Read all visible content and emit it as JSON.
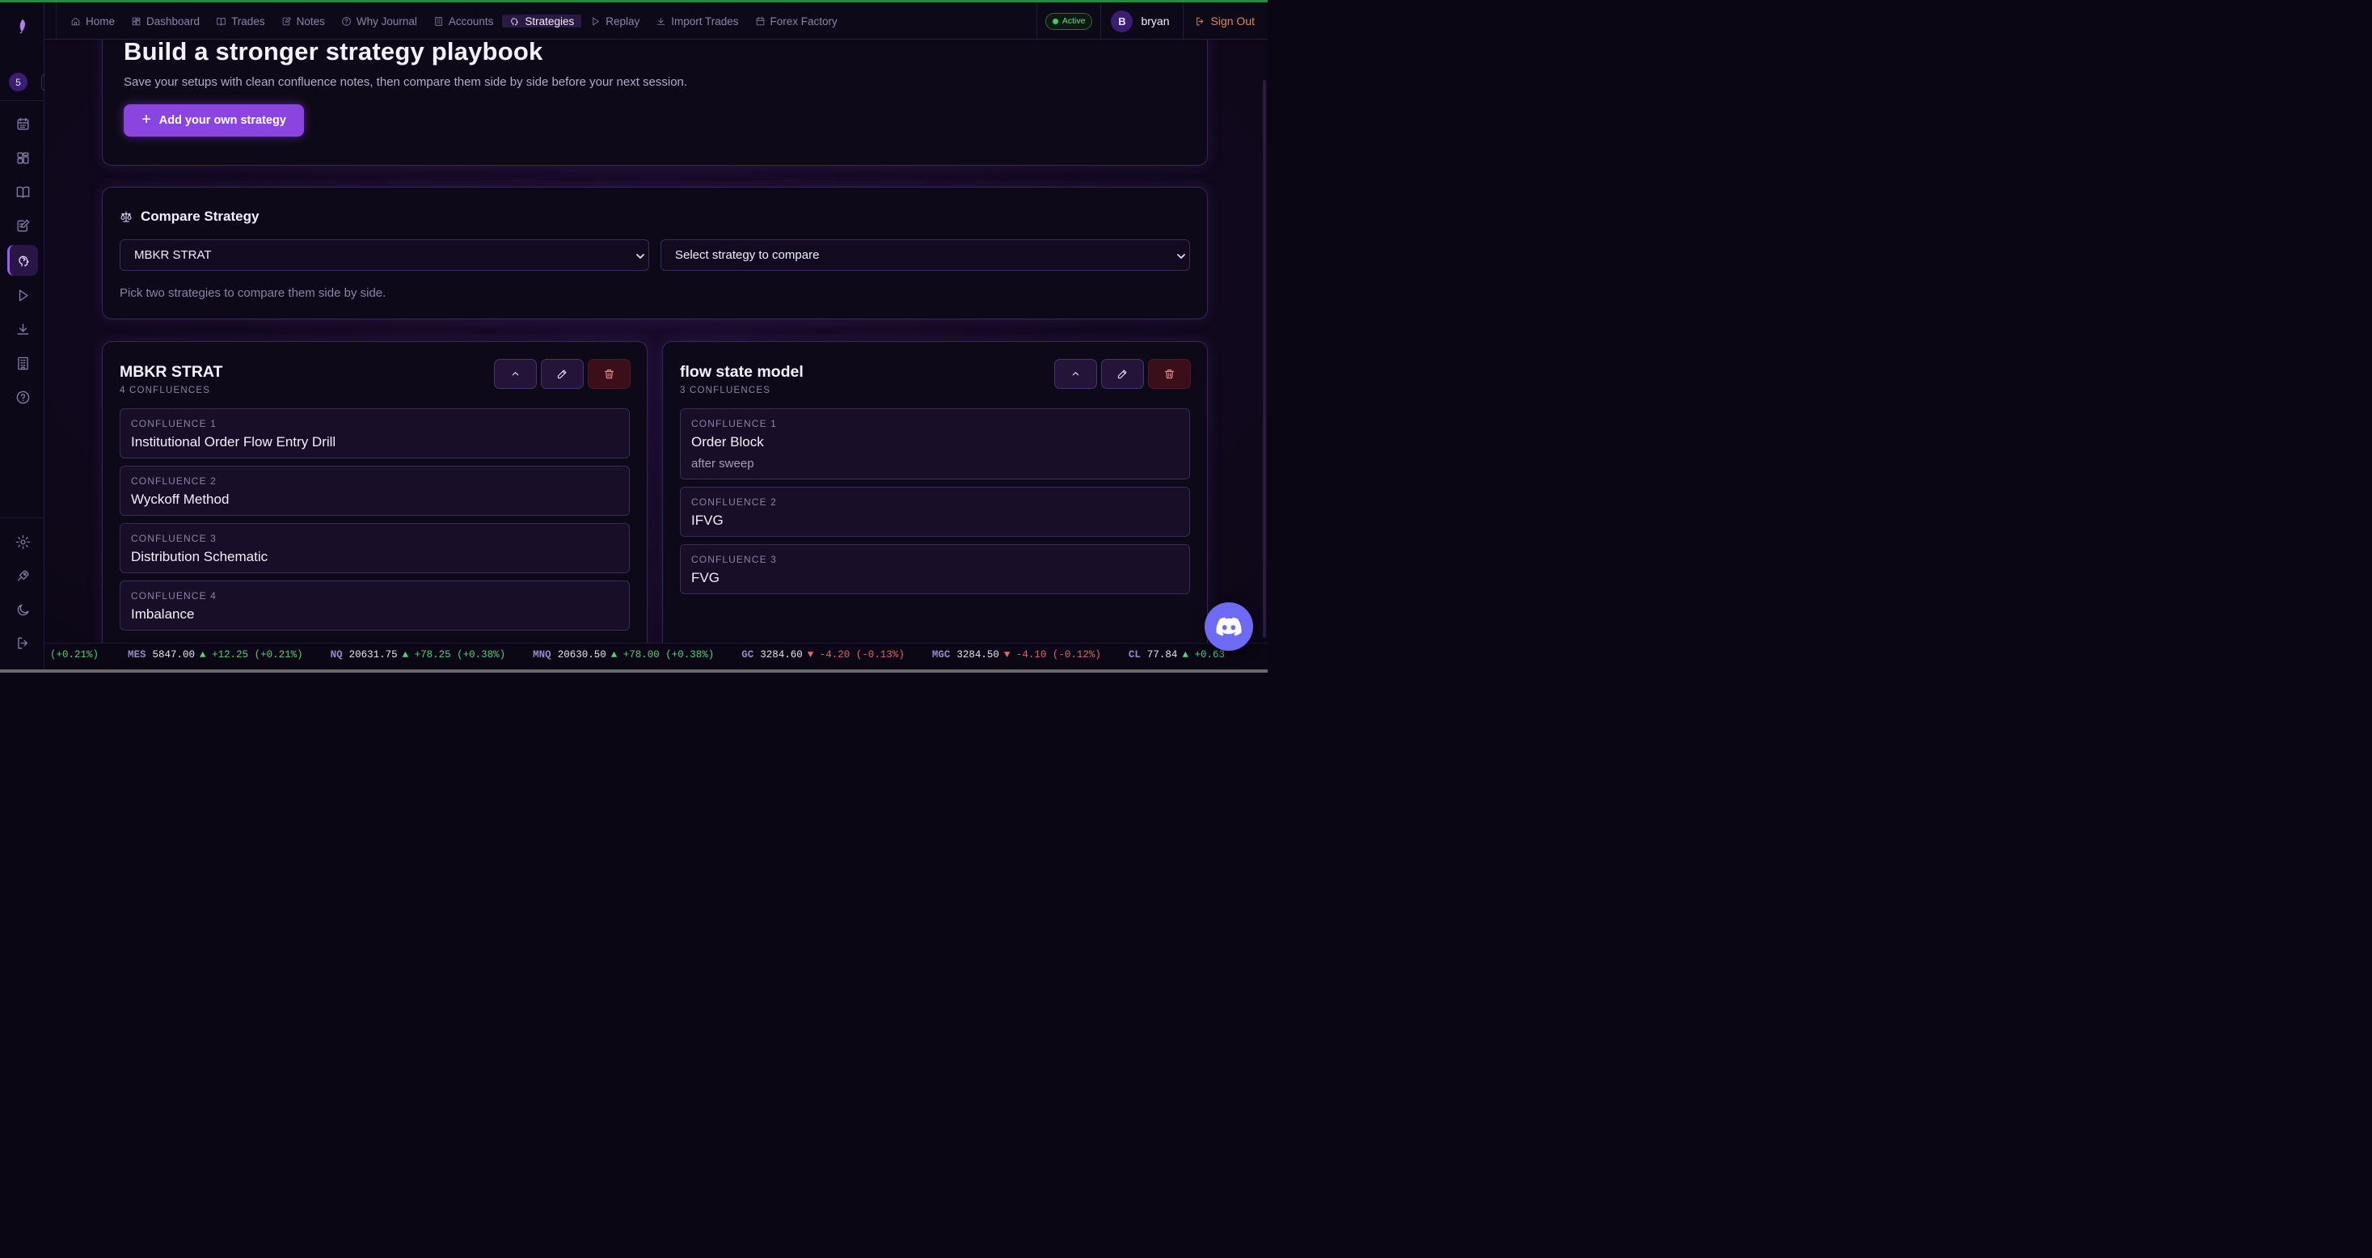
{
  "nav": {
    "items": [
      {
        "label": "Home",
        "icon": "home-icon"
      },
      {
        "label": "Dashboard",
        "icon": "dashboard-icon"
      },
      {
        "label": "Trades",
        "icon": "book-icon"
      },
      {
        "label": "Notes",
        "icon": "notes-icon"
      },
      {
        "label": "Why Journal",
        "icon": "help-icon"
      },
      {
        "label": "Accounts",
        "icon": "building-icon"
      },
      {
        "label": "Strategies",
        "icon": "brain-icon",
        "active": true
      },
      {
        "label": "Replay",
        "icon": "play-icon"
      },
      {
        "label": "Import Trades",
        "icon": "download-icon"
      },
      {
        "label": "Forex Factory",
        "icon": "calendar-icon"
      }
    ],
    "status": "Active",
    "user_initial": "B",
    "username": "bryan",
    "signout": "Sign Out"
  },
  "sidebar": {
    "badge_count": "5"
  },
  "hero": {
    "title": "Build a stronger strategy playbook",
    "subtitle": "Save your setups with clean confluence notes, then compare them side by side before your next session.",
    "add_button": "Add your own strategy"
  },
  "compare": {
    "title": "Compare Strategy",
    "left_selected": "MBKR STRAT",
    "right_placeholder": "Select strategy to compare",
    "hint": "Pick two strategies to compare them side by side."
  },
  "strategies": [
    {
      "name": "MBKR STRAT",
      "count": "4 CONFLUENCES",
      "confluences": [
        {
          "label": "CONFLUENCE 1",
          "value": "Institutional Order Flow Entry Drill",
          "note": ""
        },
        {
          "label": "CONFLUENCE 2",
          "value": "Wyckoff Method",
          "note": ""
        },
        {
          "label": "CONFLUENCE 3",
          "value": "Distribution Schematic",
          "note": ""
        },
        {
          "label": "CONFLUENCE 4",
          "value": "Imbalance",
          "note": ""
        }
      ]
    },
    {
      "name": "flow state model",
      "count": "3 CONFLUENCES",
      "confluences": [
        {
          "label": "CONFLUENCE 1",
          "value": "Order Block",
          "note": "after sweep"
        },
        {
          "label": "CONFLUENCE 2",
          "value": "IFVG",
          "note": ""
        },
        {
          "label": "CONFLUENCE 3",
          "value": "FVG",
          "note": ""
        }
      ]
    }
  ],
  "ticker": [
    {
      "sym": "",
      "price": "",
      "dir": "up",
      "change": "(+0.21%)"
    },
    {
      "sym": "MES",
      "price": "5847.00",
      "dir": "up",
      "change": "+12.25 (+0.21%)"
    },
    {
      "sym": "NQ",
      "price": "20631.75",
      "dir": "up",
      "change": "+78.25 (+0.38%)"
    },
    {
      "sym": "MNQ",
      "price": "20630.50",
      "dir": "up",
      "change": "+78.00 (+0.38%)"
    },
    {
      "sym": "GC",
      "price": "3284.60",
      "dir": "dn",
      "change": "-4.20 (-0.13%)"
    },
    {
      "sym": "MGC",
      "price": "3284.50",
      "dir": "dn",
      "change": "-4.10 (-0.12%)"
    },
    {
      "sym": "CL",
      "price": "77.84",
      "dir": "up",
      "change": "+0.63"
    }
  ],
  "colors": {
    "accent": "#8a45e0",
    "up": "#4fd27a",
    "down": "#e0666a",
    "signout": "#e0894f",
    "discord": "#6d6af3"
  }
}
